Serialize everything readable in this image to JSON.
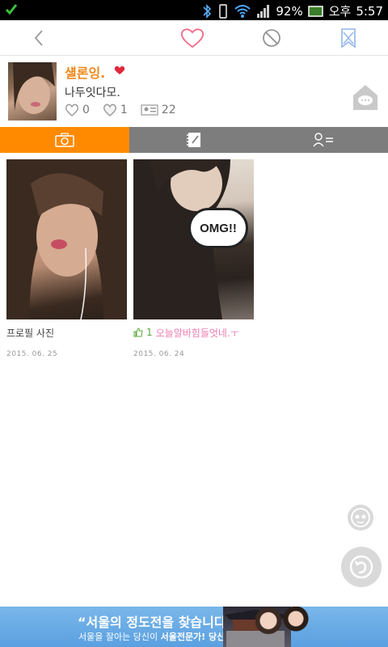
{
  "status_bar": {
    "battery": "92%",
    "ampm": "오후",
    "time": "5:57"
  },
  "toolbar": {
    "back_icon": "chevron-left-icon",
    "like_icon": "heart-outline-icon",
    "block_icon": "block-icon",
    "report_icon": "x-ribbon-icon"
  },
  "profile": {
    "name": "섈론잉.",
    "status_message": "나두잇다모.",
    "heart_count": "0",
    "like_count": "1",
    "visitor_count": "22"
  },
  "tabs": [
    {
      "icon": "camera-icon",
      "active": true
    },
    {
      "icon": "diary-icon",
      "active": false
    },
    {
      "icon": "profile-list-icon",
      "active": false
    }
  ],
  "posts": [
    {
      "caption": "프로필 사진",
      "date": "2015. 06. 25"
    },
    {
      "likes": "1",
      "caption": "오늘알바힘들엇네.ㅜ",
      "date": "2015. 06. 24",
      "photo_text": "OMG!!"
    }
  ],
  "ad": {
    "title": "“서울의 정도전을 찾습니다!”",
    "sub_prefix": "서울을 잘아는 당신이 ",
    "sub_bold": "서울전문가! 당신과 함께 만듭니다"
  },
  "colors": {
    "accent_orange": "#ff8a00",
    "name_orange": "#f08a1c",
    "tab_gray": "#7d7d7d",
    "ad_blue": "#6aaee6",
    "like_green": "#5aa83a",
    "caption_pink": "#ee7ab0"
  }
}
